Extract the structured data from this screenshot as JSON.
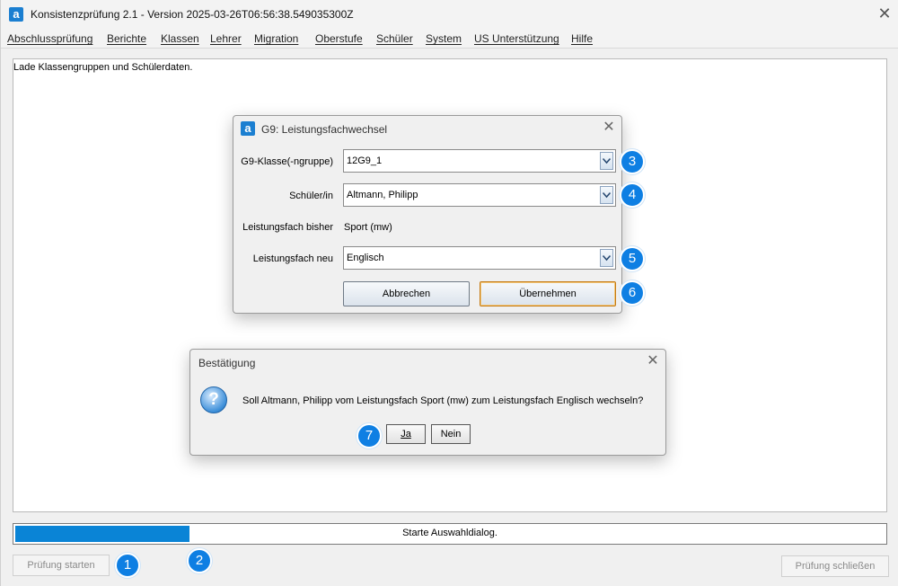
{
  "window": {
    "app_icon": "a",
    "title": "Konsistenzprüfung 2.1 - Version 2025-03-26T06:56:38.549035300Z",
    "close": "✕"
  },
  "menu": [
    "Abschlussprüfung",
    "Berichte",
    "Klassen",
    "Lehrer",
    "Migration",
    "Oberstufe",
    "Schüler",
    "System",
    "US Unterstützung",
    "Hilfe"
  ],
  "log": {
    "text": "Lade Klassengruppen und Schülerdaten."
  },
  "progress": {
    "value": 0.2,
    "text": "Starte Auswahldialog."
  },
  "buttons": {
    "start": "Prüfung starten",
    "close_check": "Prüfung schließen"
  },
  "badges": [
    "1",
    "2",
    "3",
    "4",
    "5",
    "6",
    "7"
  ],
  "g9_dialog": {
    "icon": "a",
    "title": "G9: Leistungsfachwechsel",
    "close": "✕",
    "class_label": "G9-Klasse(-ngruppe)",
    "class_value": "12G9_1",
    "student_label": "Schüler/in",
    "student_value": "Altmann, Philipp",
    "old_label": "Leistungsfach bisher",
    "old_value": "Sport (mw)",
    "new_label": "Leistungsfach neu",
    "new_value": "Englisch",
    "cancel": "Abbrechen",
    "accept": "Übernehmen"
  },
  "confirm_dialog": {
    "title": "Bestätigung",
    "close": "✕",
    "icon": "?",
    "message": "Soll Altmann, Philipp vom Leistungsfach Sport (mw) zum Leistungsfach Englisch wechseln?",
    "yes": "Ja",
    "no": "Nein"
  },
  "colors": {
    "accent": "#0a84d6",
    "badge": "#0e7fe3",
    "default_button_border": "#c57a12"
  }
}
